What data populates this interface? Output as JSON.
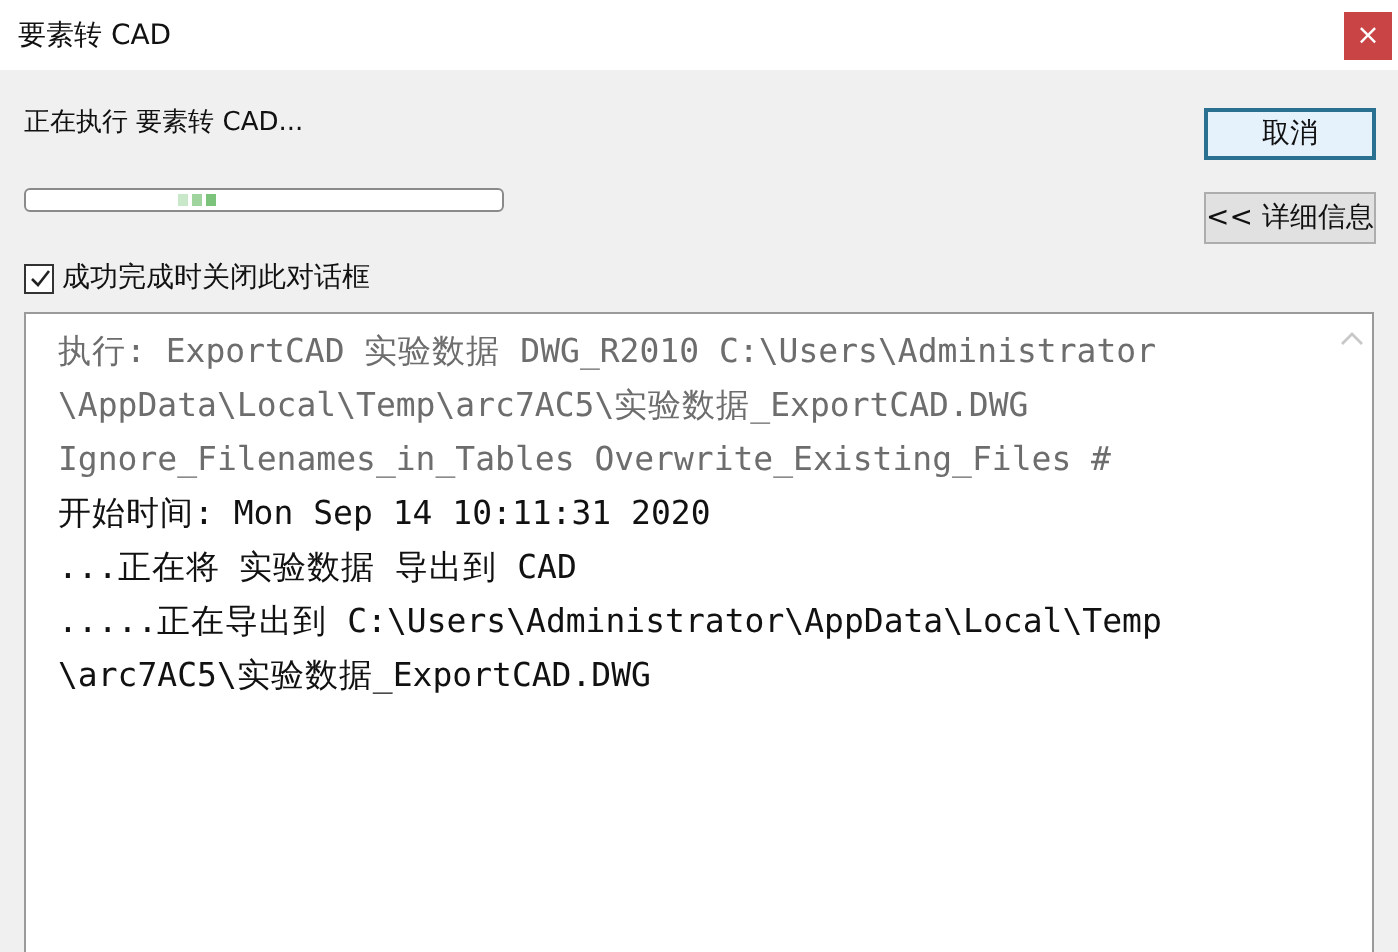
{
  "window": {
    "title": "要素转 CAD",
    "close": "×"
  },
  "status": "正在执行 要素转 CAD...",
  "progress": {
    "indeterminate": true
  },
  "buttons": {
    "cancel": "取消",
    "details": "<< 详细信息"
  },
  "close_on_complete": {
    "label": "成功完成时关闭此对话框",
    "checked": true
  },
  "log": [
    {
      "kind": "command",
      "text": "执行: ExportCAD 实验数据 DWG_R2010 C:\\Users\\Administrator"
    },
    {
      "kind": "command",
      "text": "\\AppData\\Local\\Temp\\arc7AC5\\实验数据_ExportCAD.DWG"
    },
    {
      "kind": "command",
      "text": "Ignore_Filenames_in_Tables Overwrite_Existing_Files #"
    },
    {
      "kind": "message",
      "text": "开始时间: Mon Sep 14 10:11:31 2020"
    },
    {
      "kind": "message",
      "text": "...正在将 实验数据 导出到 CAD"
    },
    {
      "kind": "message",
      "text": ".....正在导出到 C:\\Users\\Administrator\\AppData\\Local\\Temp"
    },
    {
      "kind": "message",
      "text": "\\arc7AC5\\实验数据_ExportCAD.DWG"
    }
  ]
}
